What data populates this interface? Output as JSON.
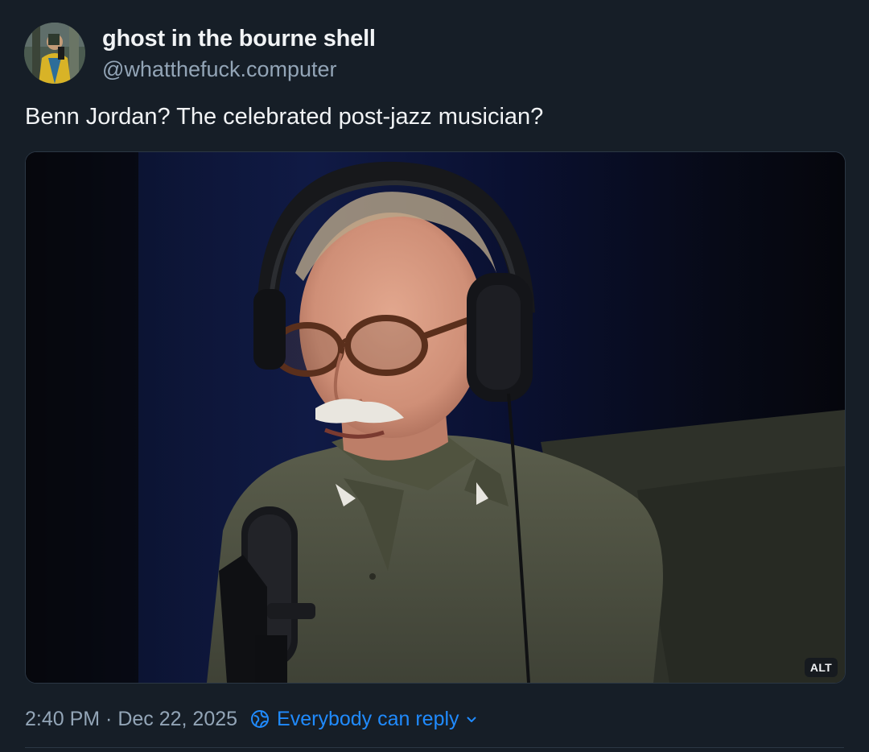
{
  "author": {
    "display_name": "ghost in the bourne shell",
    "handle": "@whatthefuck.computer"
  },
  "post": {
    "text": "Benn Jordan? The celebrated post-jazz musician?",
    "image_alt_badge": "ALT",
    "timestamp": "2:40 PM · Dec 22, 2025",
    "reply_setting": "Everybody can reply"
  },
  "icons": {
    "reply_setting": "globe-icon",
    "dropdown": "chevron-down-icon"
  },
  "colors": {
    "background": "#161e27",
    "text_primary": "#f1f3f5",
    "text_secondary": "#93a5b7",
    "accent": "#208bfe"
  }
}
